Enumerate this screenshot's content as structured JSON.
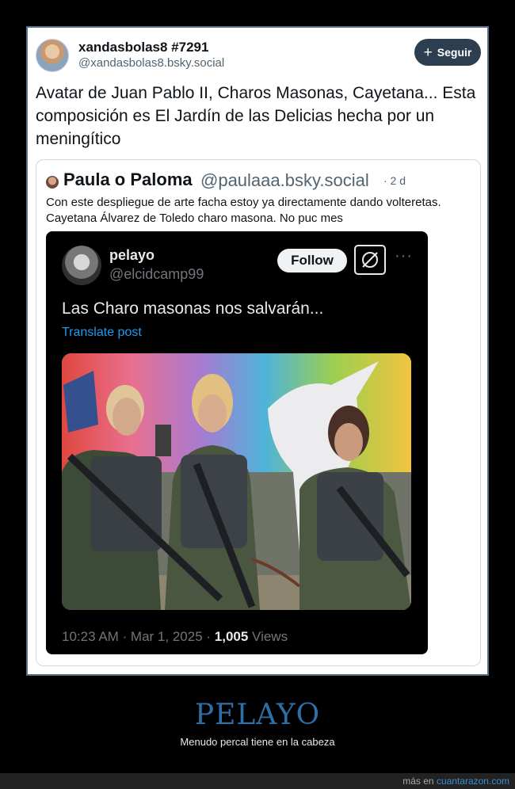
{
  "post": {
    "display_name": "xandasbolas8 #7291",
    "handle": "@xandasbolas8.bsky.social",
    "follow_label": "Seguir",
    "text": "Avatar de Juan Pablo II, Charos Masonas, Cayetana... Esta composición es El Jardín de las Delicias hecha por un meningítico"
  },
  "quote": {
    "name": "Paula o Paloma",
    "handle": "@paulaaa.bsky.social",
    "time": "· 2 d",
    "text": "Con este despliegue de arte facha estoy ya directamente dando volteretas. Cayetana Álvarez de Toledo charo masona. No puc mes"
  },
  "screenshot": {
    "name": "pelayo",
    "handle": "@elcidcamp99",
    "follow_label": "Follow",
    "more_label": "···",
    "text": "Las Charo masonas nos salvarán...",
    "translate": "Translate post",
    "time": "10:23 AM · Mar 1, 2025 · ",
    "views_count": "1,005",
    "views_label": " Views"
  },
  "caption": {
    "title": "PELAYO",
    "subtitle": "Menudo percal tiene en la cabeza"
  },
  "footer": {
    "prefix": "más en ",
    "site": "cuantarazon.com"
  },
  "colors": {
    "card_border": "#5a6f8c",
    "follow_bg": "#2c3e50",
    "x_link": "#1d9bf0",
    "caption_title": "#2f6fa7"
  },
  "icons": {
    "follow": "plus-icon",
    "grok": "grok-icon",
    "more": "more-icon"
  }
}
